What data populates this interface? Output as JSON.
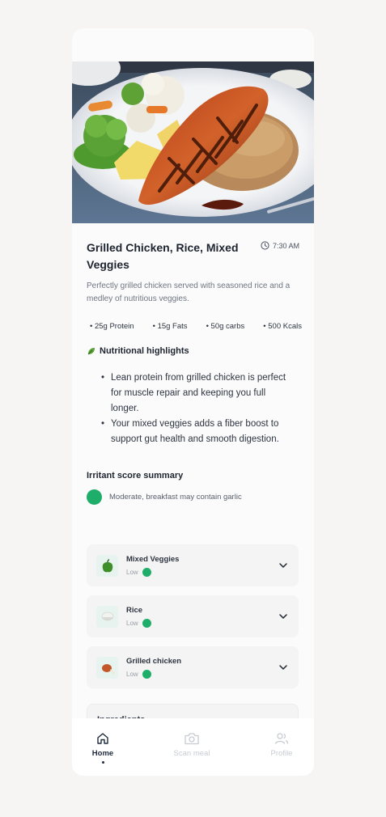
{
  "meal": {
    "title": "Grilled Chicken, Rice, Mixed Veggies",
    "time": "7:30 AM",
    "description": "Perfectly grilled chicken served with seasoned rice and a medley of nutritious veggies.",
    "macros": [
      "25g Protein",
      "15g Fats",
      "50g carbs",
      "500 Kcals"
    ]
  },
  "highlights": {
    "heading": "Nutritional highlights",
    "items": [
      "Lean protein from grilled chicken is perfect for muscle repair and keeping you full longer.",
      "Your mixed veggies adds a fiber boost to support gut health and smooth digestion."
    ]
  },
  "irritant": {
    "heading": "Irritant score summary",
    "summary": "Moderate, breakfast may contain garlic",
    "summary_color": "#1fae6a",
    "items": [
      {
        "name": "Mixed Veggies",
        "level": "Low",
        "icon": "bell-pepper-icon"
      },
      {
        "name": "Rice",
        "level": "Low",
        "icon": "rice-bowl-icon"
      },
      {
        "name": "Grilled chicken",
        "level": "Low",
        "icon": "chicken-leg-icon"
      }
    ]
  },
  "ingredients": {
    "label": "Ingredients"
  },
  "nav": {
    "home": "Home",
    "scan": "Scan meal",
    "profile": "Profile"
  },
  "colors": {
    "accent_green": "#1fae6a",
    "nav_active": "#1e2a3d",
    "nav_inactive": "#c7cbd1"
  }
}
